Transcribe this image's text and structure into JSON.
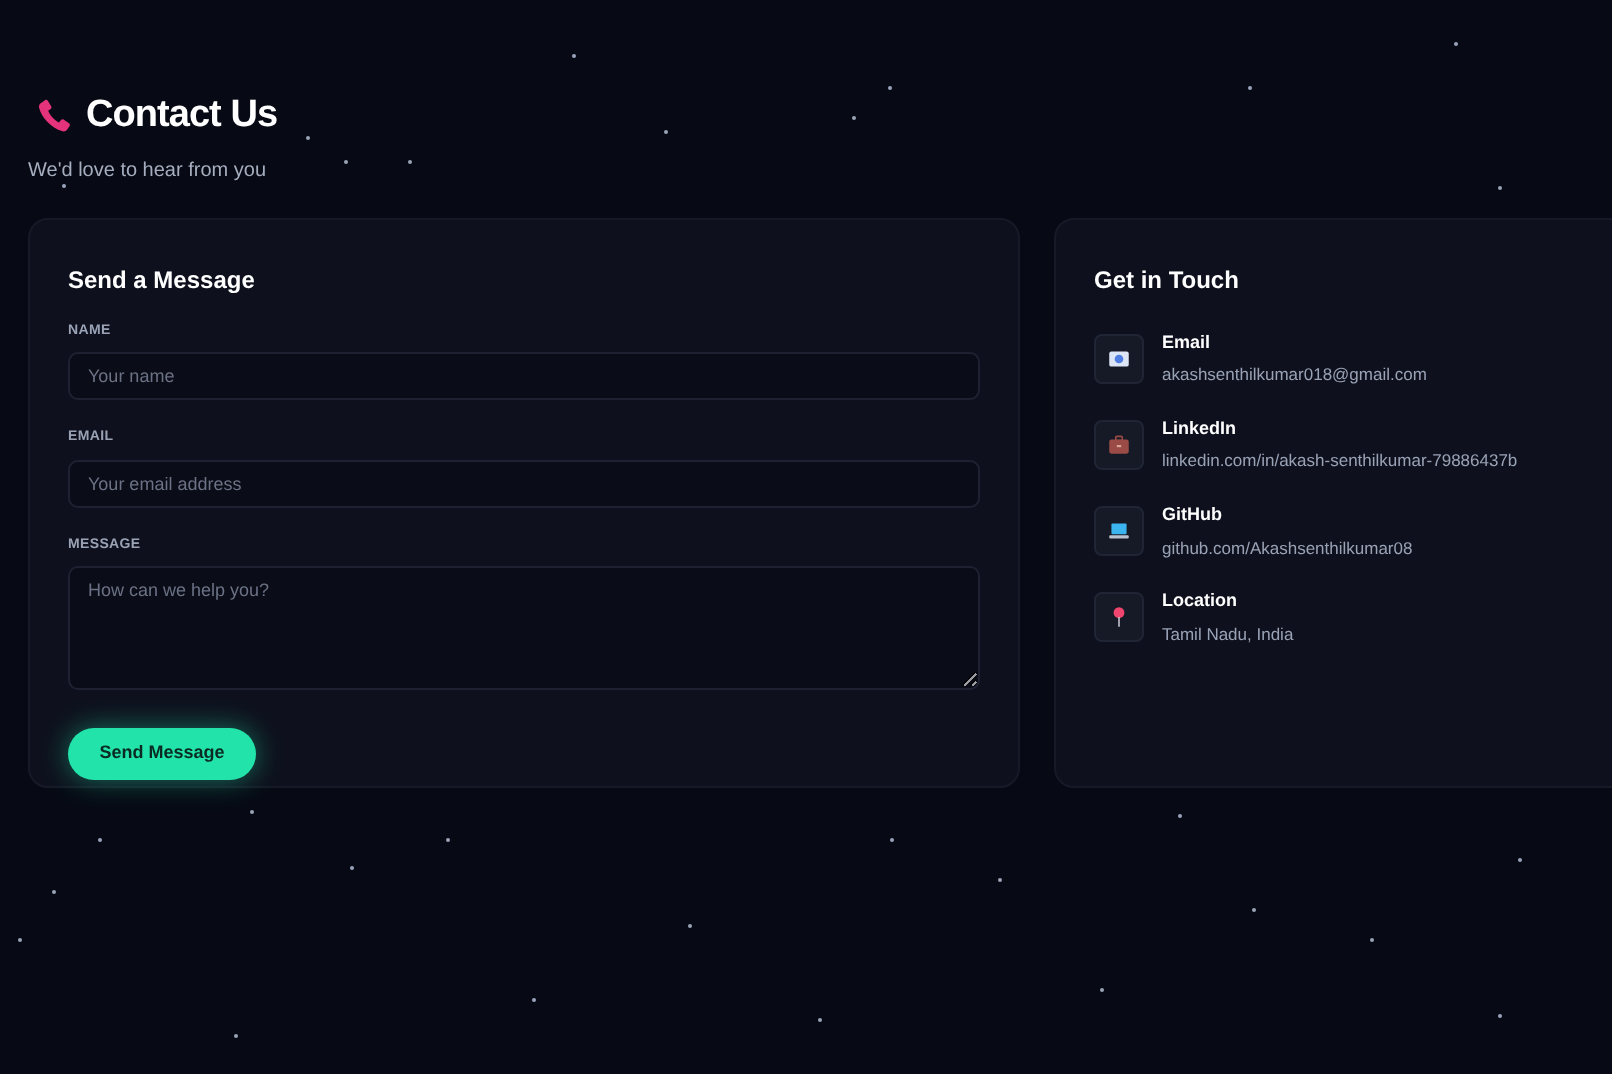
{
  "header": {
    "title": "Contact Us",
    "subtitle": "We'd love to hear from you"
  },
  "form": {
    "title": "Send a Message",
    "fields": [
      {
        "kind": "input",
        "label": "NAME",
        "placeholder": "Your name"
      },
      {
        "kind": "input",
        "label": "EMAIL",
        "placeholder": "Your email address"
      },
      {
        "kind": "textarea",
        "label": "MESSAGE",
        "placeholder": "How can we help you?"
      }
    ],
    "submit": "Send Message"
  },
  "contact": {
    "title": "Get in Touch",
    "items": [
      {
        "kind": "email",
        "label": "Email",
        "value": "akashsenthilkumar018@gmail.com"
      },
      {
        "kind": "linkedin",
        "label": "LinkedIn",
        "value": "linkedin.com/in/akash-senthilkumar-79886437b"
      },
      {
        "kind": "github",
        "label": "GitHub",
        "value": "github.com/Akashsenthilkumar08"
      },
      {
        "kind": "location",
        "label": "Location",
        "value": "Tamil Nadu, India"
      }
    ]
  }
}
